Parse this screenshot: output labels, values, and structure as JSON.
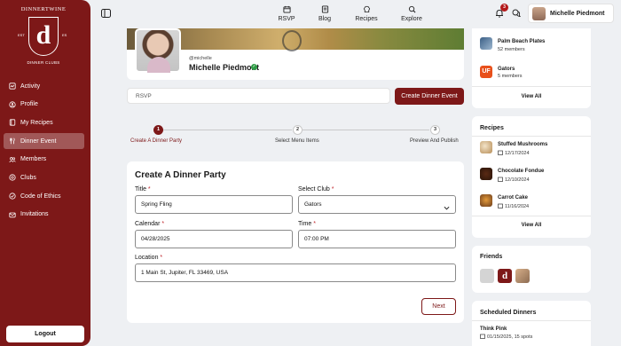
{
  "brand": {
    "title": "DINNERTWINE",
    "letter": "d",
    "est_left": "EST",
    "est_right": "ES",
    "subtitle": "DINNER CLUBS"
  },
  "sidebar": {
    "items": [
      {
        "label": "Activity",
        "icon": "activity-icon"
      },
      {
        "label": "Profile",
        "icon": "user-icon"
      },
      {
        "label": "My Recipes",
        "icon": "book-icon"
      },
      {
        "label": "Dinner Event",
        "icon": "utensils-icon",
        "active": true
      },
      {
        "label": "Members",
        "icon": "users-icon"
      },
      {
        "label": "Clubs",
        "icon": "clubs-icon"
      },
      {
        "label": "Code of Ethics",
        "icon": "ethics-icon"
      },
      {
        "label": "Invitations",
        "icon": "invitation-icon"
      }
    ],
    "logout_label": "Logout"
  },
  "topbar": {
    "tabs": [
      {
        "label": "RSVP",
        "icon": "calendar-icon"
      },
      {
        "label": "Blog",
        "icon": "blog-icon"
      },
      {
        "label": "Recipes",
        "icon": "chef-hat-icon"
      },
      {
        "label": "Explore",
        "icon": "search-icon"
      }
    ],
    "notification_count": "3",
    "user_name": "Michelle Piedmont"
  },
  "profile": {
    "handle": "@michelle",
    "name": "Michelle Piedmont"
  },
  "action_bar": {
    "input_value": "RSVP",
    "create_label": "Create Dinner Event"
  },
  "stepper": {
    "steps": [
      {
        "number": "1",
        "label": "Create A Dinner Party",
        "active": true
      },
      {
        "number": "2",
        "label": "Select Menu Items",
        "active": false
      },
      {
        "number": "3",
        "label": "Preview And Publish",
        "active": false
      }
    ]
  },
  "form": {
    "title": "Create A Dinner Party",
    "title_label": "Title",
    "title_value": "Spring Fling",
    "club_label": "Select Club",
    "club_value": "Gators",
    "calendar_label": "Calendar",
    "calendar_value": "04/28/2025",
    "time_label": "Time",
    "time_value": "07:00 PM",
    "location_label": "Location",
    "location_value": "1 Main St, Jupiter, FL 33469, USA",
    "required_mark": "*",
    "next_label": "Next"
  },
  "clubs_card": {
    "items": [
      {
        "name": "Palm Beach Plates",
        "members": "52 members"
      },
      {
        "name": "Gators",
        "members": "5 members",
        "badge": "UF"
      }
    ],
    "view_all": "View All"
  },
  "recipes_card": {
    "title": "Recipes",
    "items": [
      {
        "name": "Stuffed Mushrooms",
        "date": "12/17/2024"
      },
      {
        "name": "Chocolate Fondue",
        "date": "12/10/2024"
      },
      {
        "name": "Carrot Cake",
        "date": "11/16/2024"
      }
    ],
    "view_all": "View All"
  },
  "friends_card": {
    "title": "Friends",
    "friend_badge": "d"
  },
  "scheduled_card": {
    "title": "Scheduled Dinners",
    "items": [
      {
        "name": "Think Pink",
        "date": "01/15/2025, 15 spots"
      }
    ]
  },
  "colors": {
    "brand": "#7d1818",
    "background": "#eef0f3",
    "verified": "#2e9b45",
    "badge": "#b3191a"
  }
}
